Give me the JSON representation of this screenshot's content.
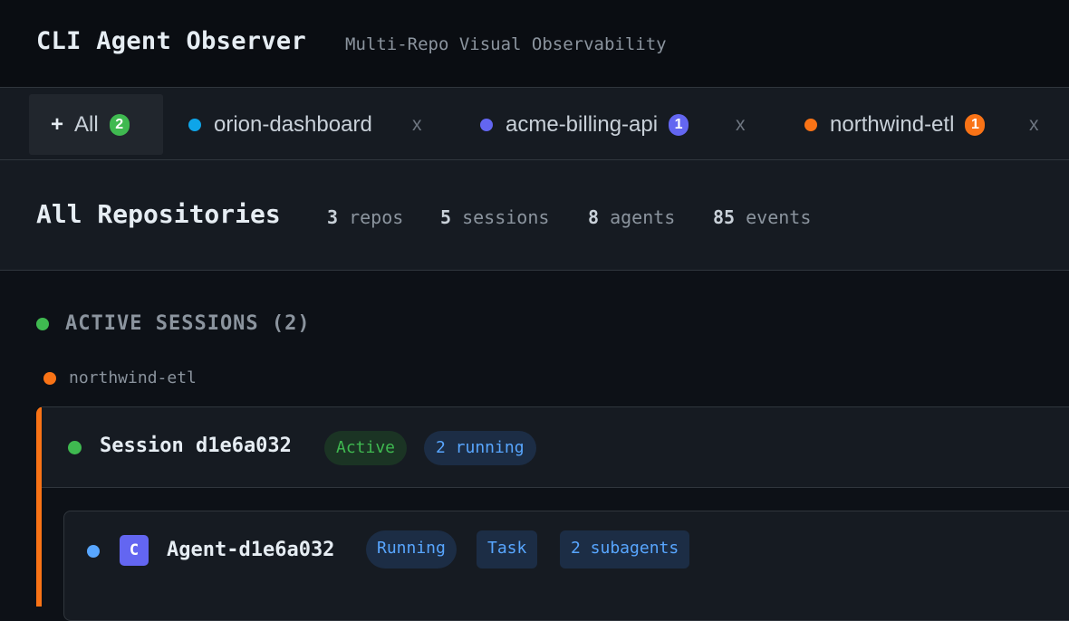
{
  "header": {
    "title": "CLI Agent Observer",
    "subtitle": "Multi-Repo Visual Observability"
  },
  "tabs": [
    {
      "label": "All",
      "icon": "plus-icon",
      "count": "2",
      "count_color": "#3fb950",
      "active": true
    },
    {
      "label": "orion-dashboard",
      "dot_color": "#0ea5e9",
      "close": "x"
    },
    {
      "label": "acme-billing-api",
      "dot_color": "#6366f1",
      "count": "1",
      "count_color": "#6366f1",
      "close": "x"
    },
    {
      "label": "northwind-etl",
      "dot_color": "#f97316",
      "count": "1",
      "count_color": "#f97316",
      "close": "x"
    }
  ],
  "summary": {
    "title": "All Repositories",
    "stats": [
      {
        "value": "3",
        "label": "repos"
      },
      {
        "value": "5",
        "label": "sessions"
      },
      {
        "value": "8",
        "label": "agents"
      },
      {
        "value": "85",
        "label": "events"
      }
    ]
  },
  "active_sessions": {
    "heading": "ACTIVE SESSIONS (2)",
    "repo_name": "northwind-etl",
    "repo_color": "#f97316",
    "session": {
      "title": "Session d1e6a032",
      "status": "Active",
      "running": "2 running",
      "agent": {
        "icon_letter": "C",
        "title": "Agent-d1e6a032",
        "status": "Running",
        "type": "Task",
        "subagents": "2 subagents"
      }
    }
  }
}
